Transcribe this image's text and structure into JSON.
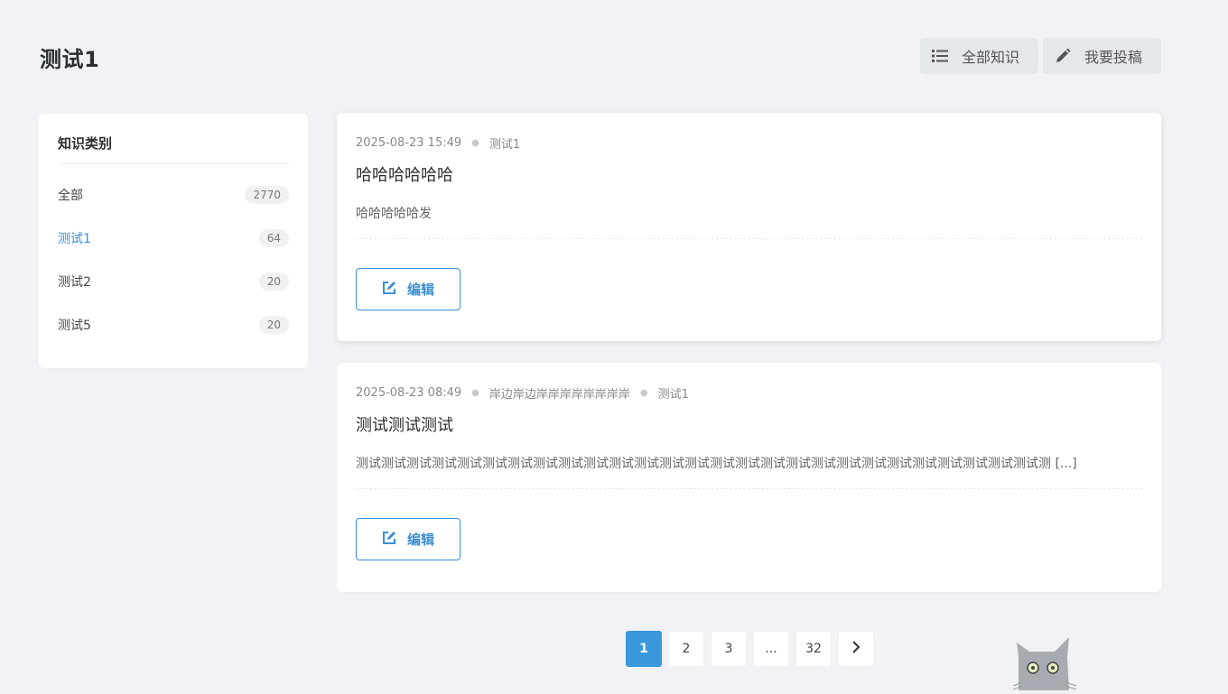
{
  "page": {
    "title": "测试1"
  },
  "header": {
    "all_knowledge_label": "全部知识",
    "contribute_label": "我要投稿"
  },
  "sidebar": {
    "title": "知识类别",
    "items": [
      {
        "label": "全部",
        "count": "2770"
      },
      {
        "label": "测试1",
        "count": "64",
        "active": true
      },
      {
        "label": "测试2",
        "count": "20"
      },
      {
        "label": "测试5",
        "count": "20"
      }
    ]
  },
  "posts": [
    {
      "datetime": "2025-08-23 15:49",
      "tags": [
        "测试1"
      ],
      "title": "哈哈哈哈哈哈",
      "excerpt": "哈哈哈哈哈发",
      "edit_label": "编辑"
    },
    {
      "datetime": "2025-08-23 08:49",
      "tags": [
        "岸边岸边岸岸岸岸岸岸岸岸",
        "测试1"
      ],
      "title": "测试测试测试",
      "excerpt": "测试测试测试测试测试测试测试测试测试测试测试测试测试测试测试测试测试测试测试测试测试测试测试测试测试测试测试测 [...]",
      "edit_label": "编辑"
    }
  ],
  "pagination": {
    "pages": [
      "1",
      "2",
      "3",
      "...",
      "32"
    ],
    "current": "1"
  },
  "colors": {
    "accent": "#3a8fd4",
    "page_active": "#3a97d9",
    "background": "#f0f2f5"
  },
  "icons": {
    "list": "list-icon",
    "pencil": "pencil-icon",
    "edit": "edit-icon",
    "next": "chevron-right-icon"
  }
}
